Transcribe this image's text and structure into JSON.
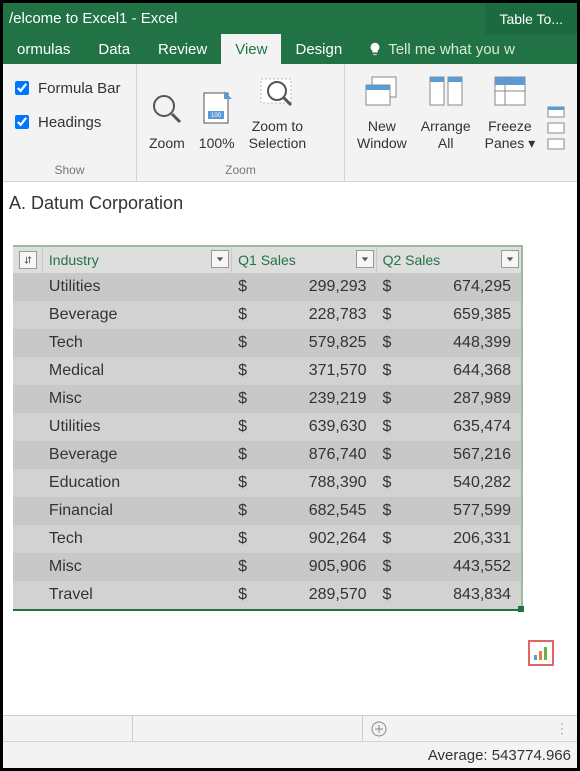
{
  "title": "/elcome to Excel1 - Excel",
  "context_tab": "Table To...",
  "tabs": [
    "ormulas",
    "Data",
    "Review",
    "View",
    "Design"
  ],
  "active_tab_index": 3,
  "tellme": "Tell me what you w",
  "ribbon": {
    "show": {
      "formula_bar": "Formula Bar",
      "headings": "Headings",
      "group": "Show"
    },
    "zoom": {
      "zoom": "Zoom",
      "p100": "100%",
      "zoom_sel": "Zoom to\nSelection",
      "group": "Zoom"
    },
    "window": {
      "new_window": "New\nWindow",
      "arrange_all": "Arrange\nAll",
      "freeze": "Freeze\nPanes ▾"
    }
  },
  "name_box": "A. Datum Corporation",
  "table": {
    "headers": [
      "Industry",
      "Q1 Sales",
      "Q2 Sales"
    ],
    "rows": [
      {
        "industry": "Utilities",
        "q1": "299,293",
        "q2": "674,295"
      },
      {
        "industry": "Beverage",
        "q1": "228,783",
        "q2": "659,385"
      },
      {
        "industry": "Tech",
        "q1": "579,825",
        "q2": "448,399"
      },
      {
        "industry": "Medical",
        "q1": "371,570",
        "q2": "644,368"
      },
      {
        "industry": "Misc",
        "q1": "239,219",
        "q2": "287,989"
      },
      {
        "industry": "Utilities",
        "q1": "639,630",
        "q2": "635,474"
      },
      {
        "industry": "Beverage",
        "q1": "876,740",
        "q2": "567,216"
      },
      {
        "industry": "Education",
        "q1": "788,390",
        "q2": "540,282"
      },
      {
        "industry": "Financial",
        "q1": "682,545",
        "q2": "577,599"
      },
      {
        "industry": "Tech",
        "q1": "902,264",
        "q2": "206,331"
      },
      {
        "industry": "Misc",
        "q1": "905,906",
        "q2": "443,552"
      },
      {
        "industry": "Travel",
        "q1": "289,570",
        "q2": "843,834"
      }
    ]
  },
  "currency": "$",
  "status_text": "Average: 543774.966"
}
